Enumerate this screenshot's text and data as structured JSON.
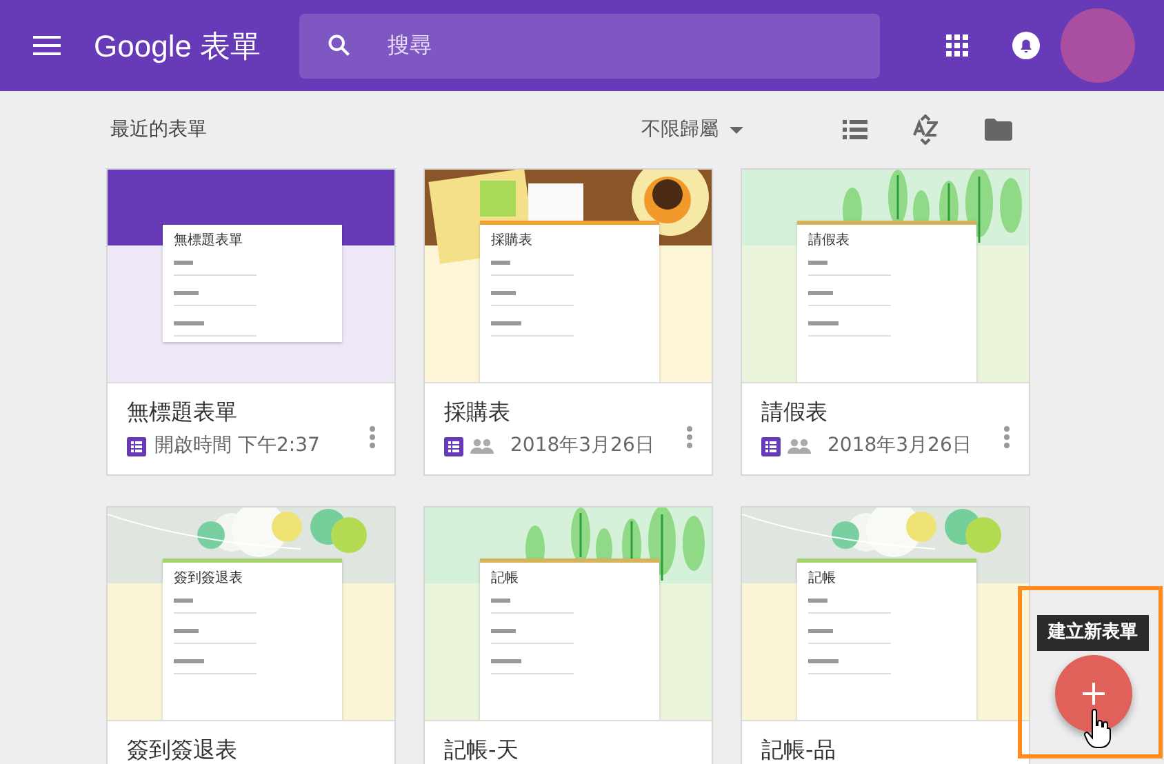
{
  "header": {
    "app_name": "Google",
    "app_suffix": "表單",
    "search": {
      "placeholder": "搜尋"
    }
  },
  "toolbar": {
    "title": "最近的表單",
    "owner_filter": "不限歸屬"
  },
  "forms": [
    {
      "title": "無標題表單",
      "preview_title": "無標題表單",
      "kind": "purple",
      "shared": false,
      "meta": "開啟時間 下午2:37"
    },
    {
      "title": "採購表",
      "preview_title": "採購表",
      "kind": "desk",
      "shared": true,
      "meta": "2018年3月26日"
    },
    {
      "title": "請假表",
      "preview_title": "請假表",
      "kind": "forest",
      "shared": true,
      "meta": "2018年3月26日"
    },
    {
      "title": "簽到簽退表",
      "preview_title": "簽到簽退表",
      "kind": "lanterns"
    },
    {
      "title": "記帳-天",
      "preview_title": "記帳",
      "kind": "forest"
    },
    {
      "title": "記帳-品",
      "preview_title": "記帳",
      "kind": "lanterns"
    }
  ],
  "fab": {
    "tooltip": "建立新表單",
    "highlighted": true
  }
}
